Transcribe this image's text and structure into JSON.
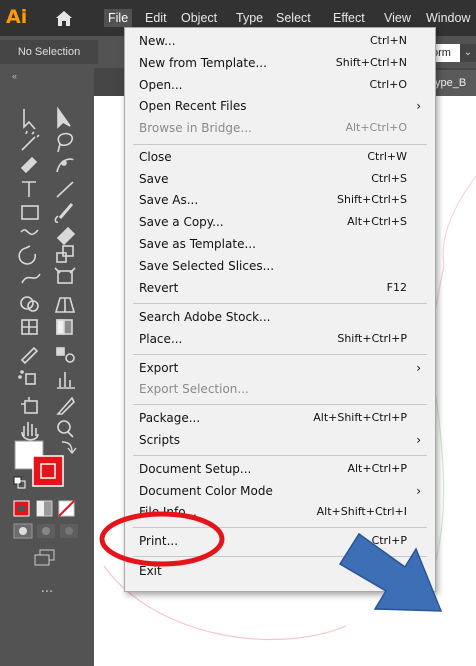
{
  "app": {
    "logo": "Ai",
    "home_icon": "home-icon"
  },
  "menubar": {
    "items": [
      "File",
      "Edit",
      "Object",
      "Type",
      "Select",
      "Effect",
      "View",
      "Window"
    ]
  },
  "controlbar": {
    "selection_label": "No Selection",
    "form_value": "orm"
  },
  "document_tab": {
    "label": "type_B"
  },
  "file_menu": {
    "items": [
      {
        "label": "New...",
        "shortcut": "Ctrl+N"
      },
      {
        "label": "New from Template...",
        "shortcut": "Shift+Ctrl+N"
      },
      {
        "label": "Open...",
        "shortcut": "Ctrl+O"
      },
      {
        "label": "Open Recent Files",
        "shortcut": "",
        "submenu": true
      },
      {
        "label": "Browse in Bridge...",
        "shortcut": "Alt+Ctrl+O",
        "disabled": true
      },
      {
        "label": "Close",
        "shortcut": "Ctrl+W"
      },
      {
        "label": "Save",
        "shortcut": "Ctrl+S"
      },
      {
        "label": "Save As...",
        "shortcut": "Shift+Ctrl+S"
      },
      {
        "label": "Save a Copy...",
        "shortcut": "Alt+Ctrl+S"
      },
      {
        "label": "Save as Template...",
        "shortcut": ""
      },
      {
        "label": "Save Selected Slices...",
        "shortcut": ""
      },
      {
        "label": "Revert",
        "shortcut": "F12"
      },
      {
        "label": "Search Adobe Stock...",
        "shortcut": ""
      },
      {
        "label": "Place...",
        "shortcut": "Shift+Ctrl+P"
      },
      {
        "label": "Export",
        "shortcut": "",
        "submenu": true
      },
      {
        "label": "Export Selection...",
        "shortcut": "",
        "disabled": true
      },
      {
        "label": "Package...",
        "shortcut": "Alt+Shift+Ctrl+P"
      },
      {
        "label": "Scripts",
        "shortcut": "",
        "submenu": true
      },
      {
        "label": "Document Setup...",
        "shortcut": "Alt+Ctrl+P"
      },
      {
        "label": "Document Color Mode",
        "shortcut": "",
        "submenu": true
      },
      {
        "label": "File Info...",
        "shortcut": "Alt+Shift+Ctrl+I"
      },
      {
        "label": "Print...",
        "shortcut": "Ctrl+P",
        "highlighted": true
      },
      {
        "label": "Exit",
        "shortcut": ""
      }
    ]
  },
  "toolbar": {
    "more_tools": "..."
  },
  "colors": {
    "menubar_bg": "#323232",
    "toolbar_bg": "#535353",
    "menu_bg": "#f1f1f1",
    "annotation_red": "#e5141b",
    "annotation_arrow": "#3d6fb6",
    "ai_logo": "#ff9a00"
  }
}
